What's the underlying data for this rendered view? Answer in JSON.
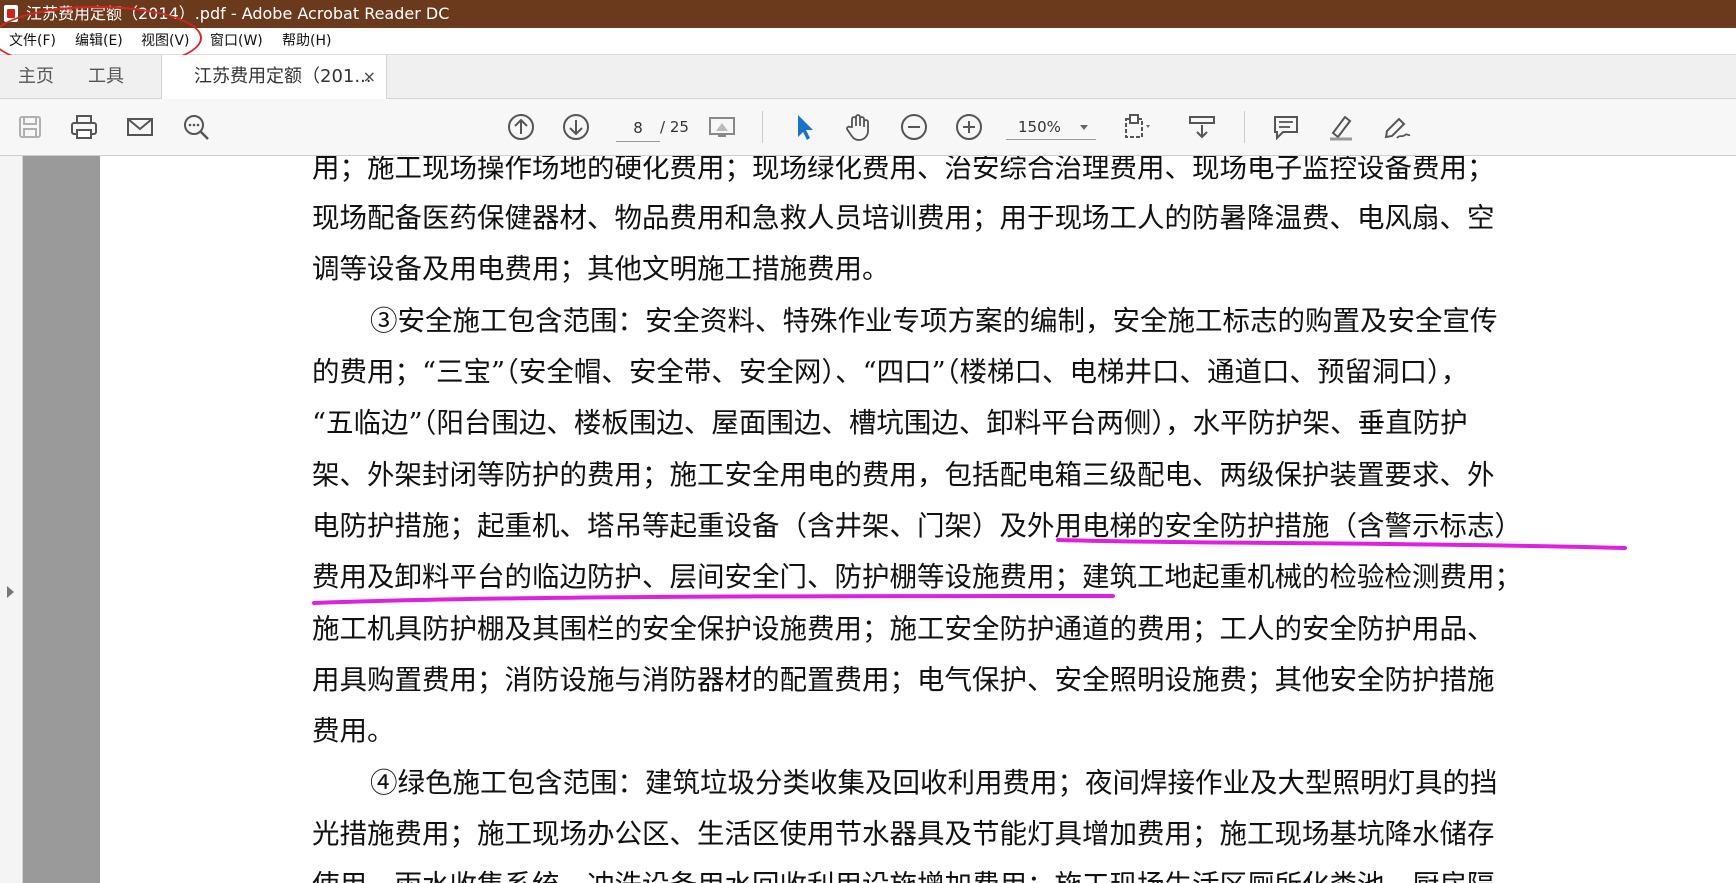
{
  "window": {
    "title": "江苏费用定额（2014）.pdf - Adobe Acrobat Reader DC"
  },
  "menu": [
    {
      "label": "文件(F)"
    },
    {
      "label": "编辑(E)"
    },
    {
      "label": "视图(V)"
    },
    {
      "label": "窗口(W)"
    },
    {
      "label": "帮助(H)"
    }
  ],
  "tabs": {
    "home": "主页",
    "tools": "工具",
    "document": "江苏费用定额（201...",
    "close_glyph": "×"
  },
  "toolbar": {
    "page_current": "8",
    "page_total": "/ 25",
    "zoom": "150%",
    "icons": [
      "save-icon",
      "print-icon",
      "email-icon",
      "search-zoom-icon",
      "page-up-icon",
      "page-down-icon",
      "page-display-icon",
      "select-pointer-icon",
      "hand-icon",
      "zoom-out-icon",
      "zoom-in-icon",
      "fit-page-icon",
      "scroll-mode-icon",
      "comment-icon",
      "highlight-icon",
      "sign-icon"
    ]
  },
  "document": {
    "lines": [
      "用；施工现场操作场地的硬化费用；现场绿化费用、治安综合治理费用、现场电子监控设备费用；",
      "现场配备医药保健器材、物品费用和急救人员培训费用；用于现场工人的防暑降温费、电风扇、空",
      "调等设备及用电费用；其他文明施工措施费用。",
      "③安全施工包含范围：安全资料、特殊作业专项方案的编制，安全施工标志的购置及安全宣传",
      "的费用；“三宝”（安全帽、安全带、安全网）、“四口”（楼梯口、电梯井口、通道口、预留洞口），",
      "“五临边”（阳台围边、楼板围边、屋面围边、槽坑围边、卸料平台两侧），水平防护架、垂直防护",
      "架、外架封闭等防护的费用；施工安全用电的费用，包括配电箱三级配电、两级保护装置要求、外",
      "电防护措施；起重机、塔吊等起重设备（含井架、门架）及外用电梯的安全防护措施（含警示标志）",
      "费用及卸料平台的临边防护、层间安全门、防护棚等设施费用；建筑工地起重机械的检验检测费用；",
      "施工机具防护棚及其围栏的安全保护设施费用；施工安全防护通道的费用；工人的安全防护用品、",
      "用具购置费用；消防设施与消防器材的配置费用；电气保护、安全照明设施费；其他安全防护措施",
      "费用。",
      "④绿色施工包含范围：建筑垃圾分类收集及回收利用费用；夜间焊接作业及大型照明灯具的挡",
      "光措施费用；施工现场办公区、生活区使用节水器具及节能灯具增加费用；施工现场基坑降水储存",
      "使用、雨水收集系统、冲洗设备用水回收利用设施增加费用；施工现场生活区厕所化粪池、厨房隔"
    ]
  },
  "colors": {
    "titlebar": "#6b3a1c",
    "annotation_red": "#e02020",
    "underline_magenta": "#e020e0"
  }
}
